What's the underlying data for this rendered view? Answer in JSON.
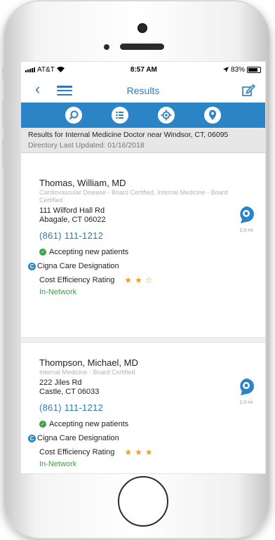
{
  "status_bar": {
    "carrier": "AT&T",
    "time": "8:57 AM",
    "battery": "83%"
  },
  "nav": {
    "title": "Results"
  },
  "toolbar": {
    "icons": [
      "search-icon",
      "list-icon",
      "location-target-icon",
      "map-pin-icon"
    ]
  },
  "banner": {
    "results_text": "Results for Internal Medicine Doctor near Windsor, CT, 06095",
    "updated_text": "Directory Last Updated: 01/16/2018"
  },
  "results": [
    {
      "name": "Thomas, William, MD",
      "specialty": "Cardiovascular Disease - Board Certified, Internal Medicine - Board Certified",
      "address_line1": "111 Wilford Hall Rd",
      "address_line2": "Abagale, CT 06022",
      "phone": "(861) 111-1212",
      "accepting": "Accepting new patients",
      "designation": "Cigna Care Designation",
      "rating_label": "Cost Efficiency Rating",
      "rating": 2,
      "rating_max": 3,
      "network": "In-Network",
      "distance": "1.0 mi"
    },
    {
      "name": "Thompson, Michael, MD",
      "specialty": "Internal Medicine - Board Certified",
      "address_line1": "222 Jiles Rd",
      "address_line2": "Castle, CT 06033",
      "phone": "(861) 111-1212",
      "accepting": "Accepting new patients",
      "designation": "Cigna Care Designation",
      "rating_label": "Cost Efficiency Rating",
      "rating": 3,
      "rating_max": 3,
      "network": "In-Network",
      "distance": "1.0 mi"
    }
  ],
  "colors": {
    "accent": "#2b7bc1",
    "toolbar": "#2b84c6",
    "star": "#f39d22",
    "network": "#3aa447"
  }
}
